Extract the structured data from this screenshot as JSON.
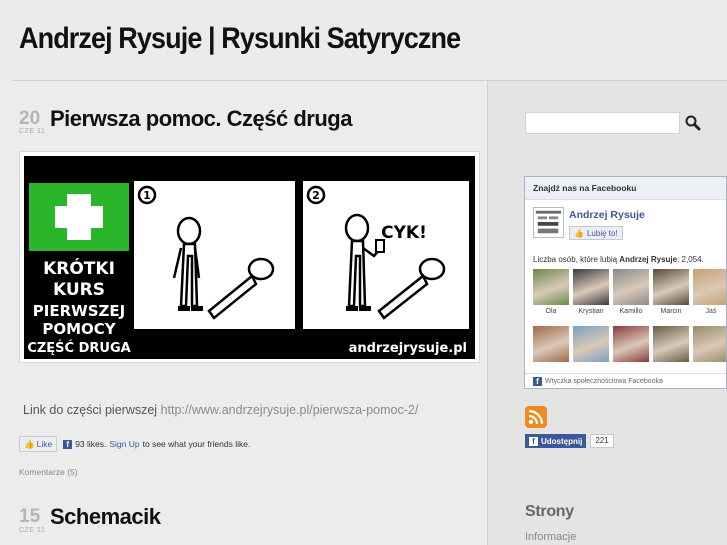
{
  "site": {
    "title": "Andrzej Rysuje | Rysunki Satyryczne"
  },
  "posts": [
    {
      "day": "20",
      "month": "CZE 11",
      "title": "Pierwsza pomoc. Część druga",
      "comic": {
        "panel_text": [
          "KRÓTKI",
          "KURS",
          "PIERWSZEJ",
          "POMOCY",
          "CZĘŚĆ DRUGA"
        ],
        "panel_numbers": [
          "1",
          "2"
        ],
        "sound": "CYK!",
        "watermark": "andrzejrysuje.pl"
      },
      "link_label": "Link do części pierwszej",
      "link_url": "http://www.andrzejrysuje.pl/pierwsza-pomoc-2/",
      "like": {
        "button": "Like",
        "count_text": "93 likes.",
        "signup": "Sign Up",
        "suffix": "to see what your friends like."
      },
      "comments": "Komentarze (5)"
    },
    {
      "day": "15",
      "month": "CZE 11",
      "title": "Schemacik"
    }
  ],
  "sidebar": {
    "search": {
      "value": "",
      "placeholder": ""
    },
    "facebook": {
      "header": "Znajdź nas na Facebooku",
      "page_name": "Andrzej Rysuje",
      "like_button": "Lubię to!",
      "count_prefix": "Liczba osób, które lubią",
      "count_name": "Andrzej Rysuje",
      "count_suffix": ": 2,054.",
      "fans": [
        {
          "name": "Ola",
          "color": "#6a8a4a"
        },
        {
          "name": "Krystian",
          "color": "#3a3a3a"
        },
        {
          "name": "Kamillo",
          "color": "#8a8a8a"
        },
        {
          "name": "Marcin",
          "color": "#5a4a3a"
        },
        {
          "name": "Jaś",
          "color": "#c9a070"
        },
        {
          "name": "",
          "color": "#a06a4a"
        },
        {
          "name": "",
          "color": "#7aa0c0"
        },
        {
          "name": "",
          "color": "#8a3a3a"
        },
        {
          "name": "",
          "color": "#6a5a4a"
        },
        {
          "name": "",
          "color": "#9a8a6a"
        }
      ],
      "footer": "Wtyczka społecznościowa Facebooka"
    },
    "share": {
      "label": "Udostępnij",
      "count": "221"
    },
    "pages_title": "Strony",
    "pages": [
      "Informacje"
    ]
  }
}
